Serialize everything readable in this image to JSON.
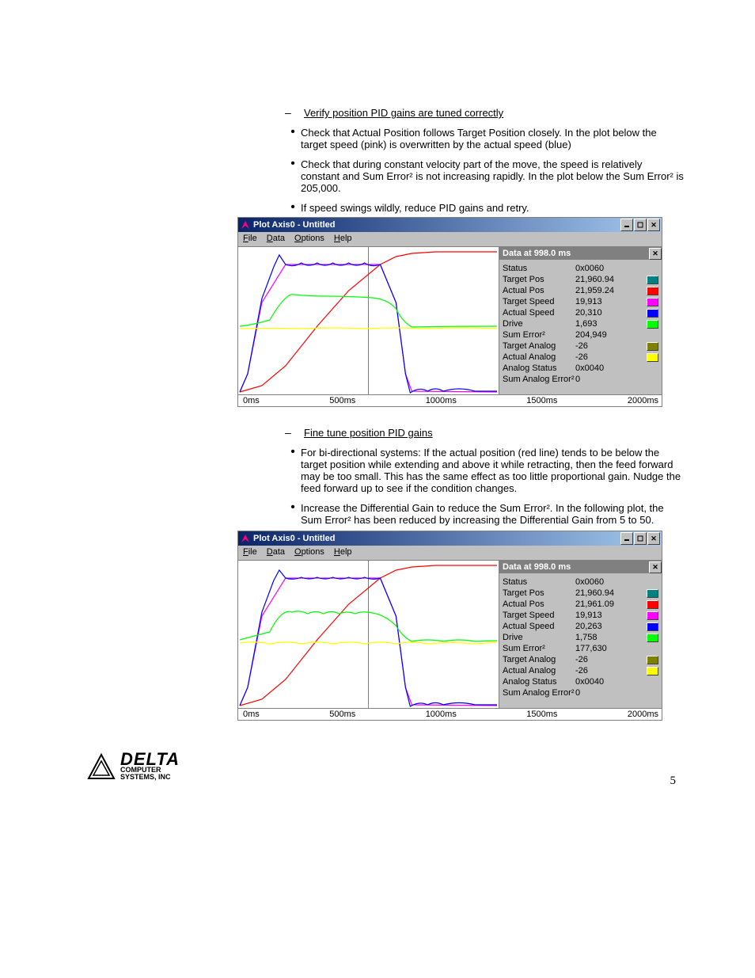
{
  "section1": {
    "heading": "Verify position PID gains are tuned correctly",
    "b1": "Check that Actual Position follows Target Position closely.  In the plot below the target speed (pink) is overwritten by the actual speed (blue)",
    "b2": "Check that during constant velocity part of the move, the speed is relatively constant and Sum Error² is not increasing rapidly.  In the plot below the Sum Error² is 205,000.",
    "b3": "If speed swings wildly, reduce PID gains and retry."
  },
  "section2": {
    "heading": "Fine tune position PID gains",
    "b1": "For bi-directional systems: If the actual position (red line) tends to be below the target position while extending and above it while retracting, then the feed forward may be too small.  This has the same effect as too little proportional gain.  Nudge the feed forward up to see if the condition changes.",
    "b2": "Increase the Differential Gain to reduce the Sum Error².  In the following plot, the Sum Error² has been reduced by increasing the Differential Gain from 5 to 50."
  },
  "plot1": {
    "title": "Plot Axis0 - Untitled",
    "menus": [
      {
        "u": "F",
        "r": "ile"
      },
      {
        "u": "D",
        "r": "ata"
      },
      {
        "u": "O",
        "r": "ptions"
      },
      {
        "u": "H",
        "r": "elp"
      }
    ],
    "data_title": "Data at 998.0 ms",
    "rows": [
      {
        "label": "Status",
        "value": "0x0060",
        "swatch": ""
      },
      {
        "label": "Target Pos",
        "value": "21,960.94",
        "swatch": "#008080"
      },
      {
        "label": "Actual Pos",
        "value": "21,959.24",
        "swatch": "#ff0000"
      },
      {
        "label": "Target Speed",
        "value": "19,913",
        "swatch": "#ff00ff"
      },
      {
        "label": "Actual Speed",
        "value": "20,310",
        "swatch": "#0000ff"
      },
      {
        "label": "Drive",
        "value": "1,693",
        "swatch": "#00ff00"
      },
      {
        "label": "Sum Error²",
        "value": "204,949",
        "swatch": ""
      },
      {
        "label": "Target Analog",
        "value": "-26",
        "swatch": "#808000"
      },
      {
        "label": "Actual Analog",
        "value": "-26",
        "swatch": "#ffff00"
      },
      {
        "label": "Analog Status",
        "value": "0x0040",
        "swatch": ""
      },
      {
        "label": "Sum Analog Error²",
        "value": "0",
        "swatch": ""
      }
    ],
    "xticks": [
      "0ms",
      "500ms",
      "1000ms",
      "1500ms",
      "2000ms"
    ]
  },
  "plot2": {
    "title": "Plot Axis0 - Untitled",
    "menus": [
      {
        "u": "F",
        "r": "ile"
      },
      {
        "u": "D",
        "r": "ata"
      },
      {
        "u": "O",
        "r": "ptions"
      },
      {
        "u": "H",
        "r": "elp"
      }
    ],
    "data_title": "Data at 998.0 ms",
    "rows": [
      {
        "label": "Status",
        "value": "0x0060",
        "swatch": ""
      },
      {
        "label": "Target Pos",
        "value": "21,960.94",
        "swatch": "#008080"
      },
      {
        "label": "Actual Pos",
        "value": "21,961.09",
        "swatch": "#ff0000"
      },
      {
        "label": "Target Speed",
        "value": "19,913",
        "swatch": "#ff00ff"
      },
      {
        "label": "Actual Speed",
        "value": "20,263",
        "swatch": "#0000ff"
      },
      {
        "label": "Drive",
        "value": "1,758",
        "swatch": "#00ff00"
      },
      {
        "label": "Sum Error²",
        "value": "177,630",
        "swatch": ""
      },
      {
        "label": "Target Analog",
        "value": "-26",
        "swatch": "#808000"
      },
      {
        "label": "Actual Analog",
        "value": "-26",
        "swatch": "#ffff00"
      },
      {
        "label": "Analog Status",
        "value": "0x0040",
        "swatch": ""
      },
      {
        "label": "Sum Analog Error²",
        "value": "0",
        "swatch": ""
      }
    ],
    "xticks": [
      "0ms",
      "500ms",
      "1000ms",
      "1500ms",
      "2000ms"
    ]
  },
  "footer": {
    "brand": "DELTA",
    "sub1": "COMPUTER",
    "sub2": "SYSTEMS, INC",
    "page": "5"
  },
  "chart_data": [
    {
      "type": "line",
      "title": "Plot Axis0 - Untitled",
      "x_unit": "ms",
      "xlim": [
        0,
        2000
      ],
      "data_cursor_ms": 998.0,
      "series": [
        {
          "name": "Target Pos",
          "color": "#008080",
          "ylim_approx": [
            0,
            30000
          ],
          "value_at_cursor": 21960.94
        },
        {
          "name": "Actual Pos",
          "color": "#ff0000",
          "ylim_approx": [
            0,
            30000
          ],
          "value_at_cursor": 21959.24
        },
        {
          "name": "Target Speed",
          "color": "#ff00ff",
          "ylim_approx": [
            0,
            22000
          ],
          "value_at_cursor": 19913
        },
        {
          "name": "Actual Speed",
          "color": "#0000ff",
          "ylim_approx": [
            0,
            22000
          ],
          "value_at_cursor": 20310
        },
        {
          "name": "Drive",
          "color": "#00ff00",
          "ylim_approx": [
            0,
            2500
          ],
          "value_at_cursor": 1693
        },
        {
          "name": "Target Analog",
          "color": "#808000",
          "value_at_cursor": -26
        },
        {
          "name": "Actual Analog",
          "color": "#ffff00",
          "value_at_cursor": -26
        }
      ],
      "status": "0x0060",
      "sum_error2": 204949,
      "analog_status": "0x0040",
      "sum_analog_error2": 0
    },
    {
      "type": "line",
      "title": "Plot Axis0 - Untitled",
      "x_unit": "ms",
      "xlim": [
        0,
        2000
      ],
      "data_cursor_ms": 998.0,
      "series": [
        {
          "name": "Target Pos",
          "color": "#008080",
          "ylim_approx": [
            0,
            30000
          ],
          "value_at_cursor": 21960.94
        },
        {
          "name": "Actual Pos",
          "color": "#ff0000",
          "ylim_approx": [
            0,
            30000
          ],
          "value_at_cursor": 21961.09
        },
        {
          "name": "Target Speed",
          "color": "#ff00ff",
          "ylim_approx": [
            0,
            22000
          ],
          "value_at_cursor": 19913
        },
        {
          "name": "Actual Speed",
          "color": "#0000ff",
          "ylim_approx": [
            0,
            22000
          ],
          "value_at_cursor": 20263
        },
        {
          "name": "Drive",
          "color": "#00ff00",
          "ylim_approx": [
            0,
            2500
          ],
          "value_at_cursor": 1758
        },
        {
          "name": "Target Analog",
          "color": "#808000",
          "value_at_cursor": -26
        },
        {
          "name": "Actual Analog",
          "color": "#ffff00",
          "value_at_cursor": -26
        }
      ],
      "status": "0x0060",
      "sum_error2": 177630,
      "analog_status": "0x0040",
      "sum_analog_error2": 0
    }
  ]
}
